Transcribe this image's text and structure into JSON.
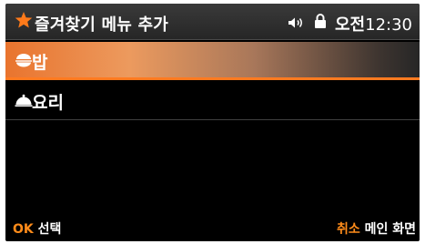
{
  "title_bar": {
    "icon": "star-icon",
    "title": "즐겨찾기 메뉴 추가"
  },
  "status_bar": {
    "speaker_icon": "speaker-icon",
    "lock_icon": "lock-icon",
    "ampm": "오전",
    "time": "12:30"
  },
  "menu": {
    "items": [
      {
        "label": "밥",
        "icon": "rice-bowl-icon",
        "selected": true
      },
      {
        "label": "요리",
        "icon": "dish-cover-icon",
        "selected": false
      }
    ]
  },
  "softkeys": {
    "left": {
      "key": "OK",
      "label": "선택"
    },
    "right": {
      "key": "취소",
      "label": "메인 화면"
    }
  },
  "colors": {
    "accent": "#ff8c1a",
    "highlight_start": "#e9742e",
    "background": "#000000"
  }
}
